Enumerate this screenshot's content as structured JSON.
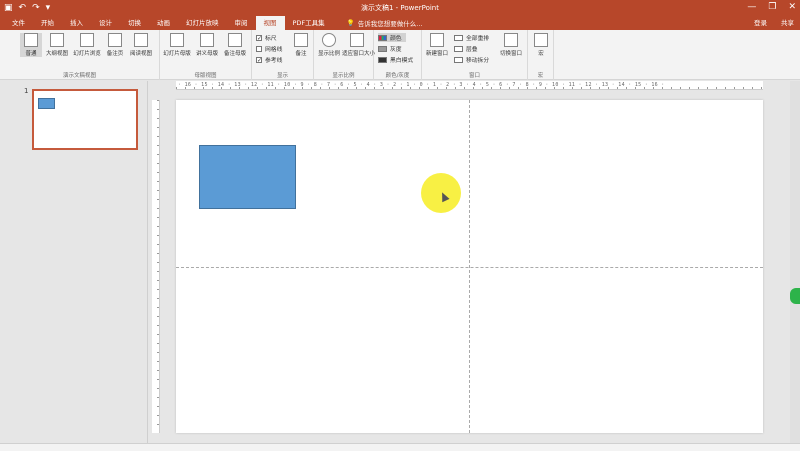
{
  "window": {
    "title": "演示文稿1 - PowerPoint"
  },
  "qat": {
    "save_icon": "save-icon",
    "undo_icon": "undo-icon",
    "redo_icon": "redo-icon",
    "customize_icon": "customize-icon"
  },
  "window_controls": {
    "minimize": "—",
    "restore": "❐",
    "close": "✕"
  },
  "tabs": [
    {
      "label": "文件"
    },
    {
      "label": "开始"
    },
    {
      "label": "插入"
    },
    {
      "label": "设计"
    },
    {
      "label": "切换"
    },
    {
      "label": "动画"
    },
    {
      "label": "幻灯片放映"
    },
    {
      "label": "审阅"
    },
    {
      "label": "视图"
    },
    {
      "label": "PDF工具集"
    }
  ],
  "tabs_active": "视图",
  "search": {
    "placeholder": "告诉我您想要做什么..."
  },
  "account": {
    "login": "登录",
    "share": "共享"
  },
  "ribbon": {
    "presentation_views": {
      "label": "演示文稿视图",
      "buttons": [
        "普通",
        "大纲视图",
        "幻灯片浏览",
        "备注页",
        "阅读视图"
      ]
    },
    "master_views": {
      "label": "母版视图",
      "buttons": [
        "幻灯片母版",
        "讲义母版",
        "备注母版"
      ]
    },
    "show": {
      "label": "显示",
      "checks": [
        {
          "label": "标尺",
          "checked": true
        },
        {
          "label": "网格线",
          "checked": false
        },
        {
          "label": "参考线",
          "checked": true
        }
      ],
      "notes_button": "备注"
    },
    "zoom": {
      "label": "显示比例",
      "zoom_button": "显示比例",
      "fit_button": "适应窗口大小"
    },
    "color": {
      "label": "颜色/灰度",
      "items": [
        "颜色",
        "灰度",
        "黑白模式"
      ],
      "selected": "颜色"
    },
    "window": {
      "label": "窗口",
      "new_window": "新建窗口",
      "items": [
        "全部重排",
        "层叠",
        "移动拆分"
      ],
      "switch": "切换窗口"
    },
    "macro": {
      "label": "宏"
    }
  },
  "thumbnails": [
    {
      "number": "1"
    }
  ],
  "ruler": {
    "h_text": "· 16 · 15 · 14 · 13 · 12 · 11 · 10 · 9 · 8 · 7 · 6 · 5 · 4 · 3 · 2 · 1 · 0 · 1 · 2 · 3 · 4 · 5 · 6 · 7 · 8 · 9 · 10 · 11 · 12 · 13 · 14 · 15 · 16 ·"
  },
  "colors": {
    "accent": "#b7472a",
    "shape_fill": "#5b9bd5",
    "shape_border": "#41719c",
    "highlight": "#f8ef3a"
  }
}
